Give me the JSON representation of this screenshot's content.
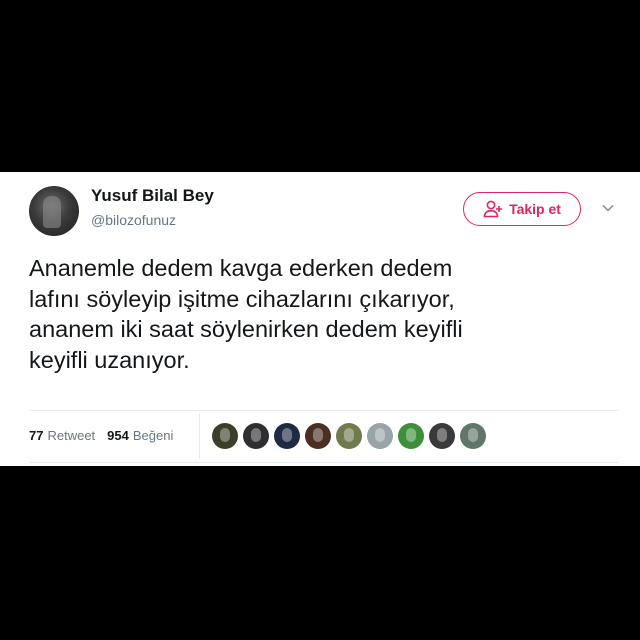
{
  "user": {
    "name": "Yusuf Bilal Bey",
    "handle": "@bilozofunuz"
  },
  "follow_button": {
    "label": "Takip et",
    "icon": "add-user-icon",
    "color": "#e0245e"
  },
  "more_icon": "chevron-down-icon",
  "tweet": {
    "text": "Ananemle dedem kavga ederken dedem\nlafını söyleyip işitme cihazlarını çıkarıyor,\nananem iki saat söylenirken dedem keyifli\nkeyifli uzanıyor."
  },
  "stats": {
    "retweet_count": "77",
    "retweet_label": "Retweet",
    "like_count": "954",
    "like_label": "Beğeni"
  },
  "likers": [
    {
      "color": "#3b3f2a"
    },
    {
      "color": "#2f2f33"
    },
    {
      "color": "#1f2a44"
    },
    {
      "color": "#4a2f22"
    },
    {
      "color": "#6f7a4d"
    },
    {
      "color": "#9aa3a8"
    },
    {
      "color": "#3e8f3a"
    },
    {
      "color": "#3a3a3a"
    },
    {
      "color": "#5f7668"
    }
  ]
}
